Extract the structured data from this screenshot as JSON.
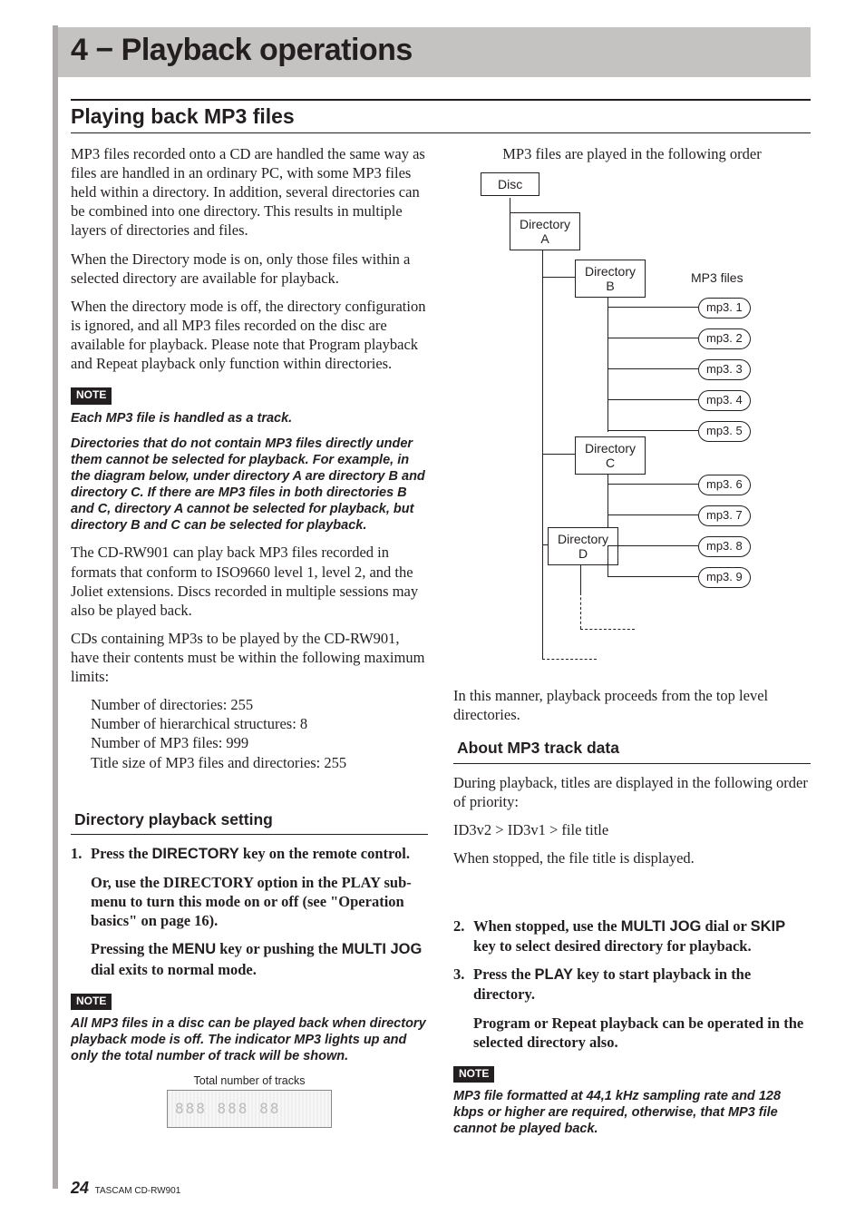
{
  "chapter": {
    "title": "4 − Playback operations"
  },
  "section": {
    "heading": "Playing back MP3 files"
  },
  "left": {
    "p1": "MP3 files recorded onto a CD are handled the same way as files are handled in an ordinary PC, with some MP3 files held within a directory. In addition, several directories can be combined into one directory. This results in multiple layers of directories and files.",
    "p2": "When the Directory mode is on, only those files within a selected directory are available for playback.",
    "p3": "When the directory mode is off, the directory configuration is ignored, and all MP3 files recorded on the disc are available for playback. Please note that Program playback and Repeat playback only function within directories.",
    "note1_label": "NOTE",
    "note1a": "Each MP3 file is handled as a track.",
    "note1b": "Directories that do not contain MP3 files directly under them cannot be selected for playback. For example, in the diagram below, under directory A are directory B and directory C. If there are MP3 files in both directories B and C, directory A cannot be selected for playback, but directory B and C can be selected for playback.",
    "p4": "The CD-RW901 can play back MP3 files recorded in formats that conform to ISO9660 level 1, level 2, and the Joliet extensions. Discs recorded in multiple sessions may also be played back.",
    "p5": "CDs containing MP3s to be played by the CD-RW901, have their contents must be within the following maximum limits:",
    "limits": {
      "l1": "Number of directories: 255",
      "l2": "Number of hierarchical structures: 8",
      "l3": "Number of MP3 files: 999",
      "l4": "Title size of MP3 files and directories: 255"
    },
    "sub1": "Directory playback setting",
    "step1_pre": "Press the ",
    "step1_key": "DIRECTORY",
    "step1_post": " key on the remote control.",
    "step1b": "Or, use the DIRECTORY option in the PLAY sub-menu to turn this mode on or off (see \"Operation basics\" on page 16).",
    "step1c_pre": "Pressing the ",
    "step1c_k1": "MENU",
    "step1c_mid": " key or pushing the ",
    "step1c_k2": "MULTI JOG",
    "step1c_post": " dial exits to normal mode.",
    "note2_label": "NOTE",
    "note2": "All MP3 files in a disc can be played back when directory playback mode is off. The indicator MP3 lights up and only the total number of track will be shown.",
    "caption": "Total number of tracks"
  },
  "right": {
    "intro": "MP3 files are played in the following order",
    "diagram": {
      "disc": "Disc",
      "dirA": "Directory\nA",
      "dirB": "Directory\nB",
      "dirC": "Directory\nC",
      "dirD": "Directory\nD",
      "mp3label": "MP3 files",
      "files": [
        "mp3. 1",
        "mp3. 2",
        "mp3. 3",
        "mp3. 4",
        "mp3. 5",
        "mp3. 6",
        "mp3. 7",
        "mp3. 8",
        "mp3. 9"
      ]
    },
    "after_diagram": "In this manner, playback proceeds from the top level directories.",
    "sub2": "About MP3 track data",
    "p6": "During playback, titles are displayed in the following order of priority:",
    "p7": "ID3v2 > ID3v1 > file title",
    "p8": "When stopped, the file title is displayed.",
    "step2_pre": "When stopped, use the ",
    "step2_k1": "MULTI JOG",
    "step2_mid": " dial or ",
    "step2_k2": "SKIP",
    "step2_post": " key to select desired directory for playback.",
    "step3_pre": "Press the ",
    "step3_k": "PLAY",
    "step3_post": " key to start playback in the directory.",
    "step3b": "Program or Repeat playback can be operated in the selected directory also.",
    "note3_label": "NOTE",
    "note3": "MP3 file formatted at 44,1 kHz sampling rate and 128 kbps or higher are required, otherwise, that MP3 file cannot be played back."
  },
  "footer": {
    "page": "24",
    "model": "TASCAM  CD-RW901"
  }
}
